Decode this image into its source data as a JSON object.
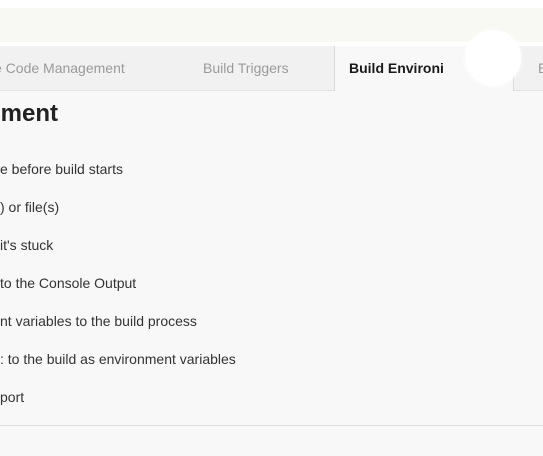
{
  "tabs": [
    {
      "label": "e Code Management"
    },
    {
      "label": "Build Triggers"
    },
    {
      "label": "Build Environi"
    },
    {
      "label": "E"
    }
  ],
  "section": {
    "title": "nment",
    "options": [
      {
        "label": "e before build starts"
      },
      {
        "label": ") or file(s)"
      },
      {
        "label": "it's stuck"
      },
      {
        "label": "to the Console Output"
      },
      {
        "label": "nt variables to the build process"
      },
      {
        "label": ": to the build as environment variables"
      },
      {
        "label": "port"
      }
    ]
  },
  "colors": {
    "header_band": "#f7f9f2",
    "tabbar_bg": "#f1f1f1",
    "content_bg": "#f8f8f8",
    "active_tab_text": "#1a1a1a",
    "inactive_tab_text": "#9a9a9a"
  }
}
